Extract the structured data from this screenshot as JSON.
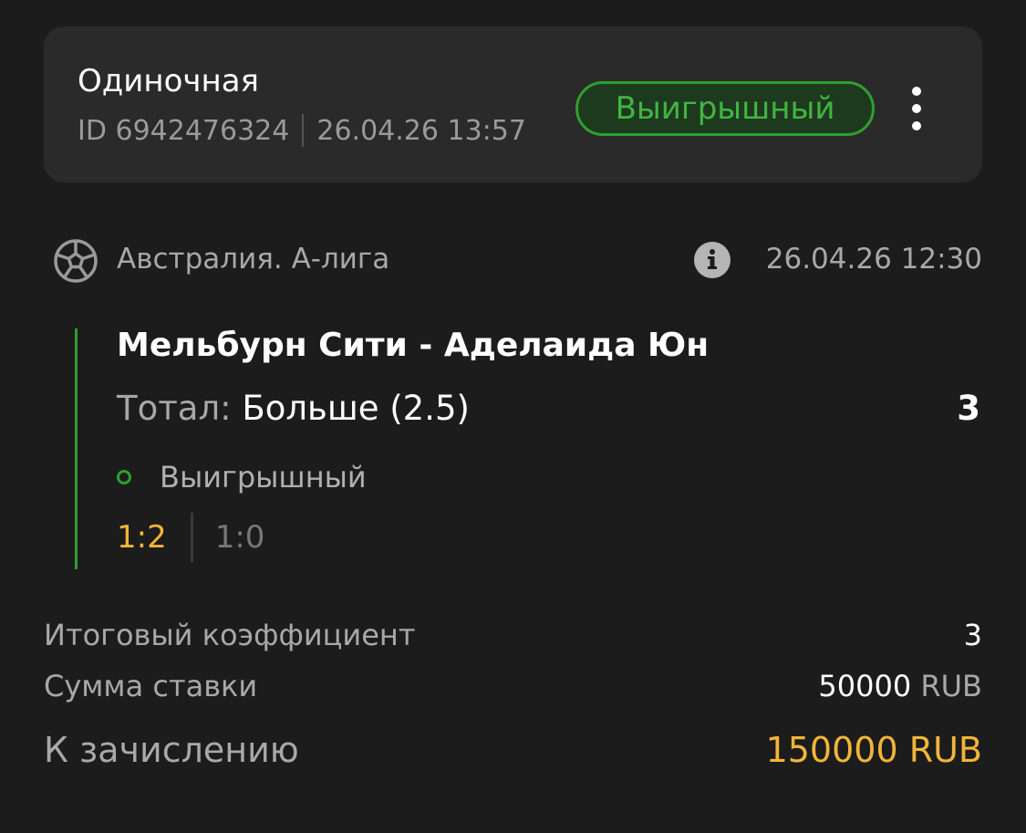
{
  "header": {
    "bet_type": "Одиночная",
    "id_text": "ID 6942476324",
    "datetime": "26.04.26 13:57",
    "status": "Выигрышный"
  },
  "event": {
    "league": "Австралия. А-лига",
    "time": "26.04.26 12:30",
    "match": "Мельбурн Сити - Аделаида Юн",
    "market_label": "Тотал:",
    "market_value": "Больше (2.5)",
    "odd": "3",
    "status": "Выигрышный",
    "score_final": "1:2",
    "score_half": "1:0",
    "sport_icon": "soccer-ball-icon",
    "info_icon": "info-icon"
  },
  "summary": {
    "odds_label": "Итоговый коэффициент",
    "odds_value": "3",
    "stake_label": "Сумма ставки",
    "stake_amount": "50000",
    "stake_currency": "RUB",
    "payout_label": "К зачислению",
    "payout_value": "150000 RUB"
  },
  "colors": {
    "background": "#1c1c1c",
    "card": "#2a2a2a",
    "win_green": "#2f9e2f",
    "accent_yellow": "#f2b53a"
  }
}
